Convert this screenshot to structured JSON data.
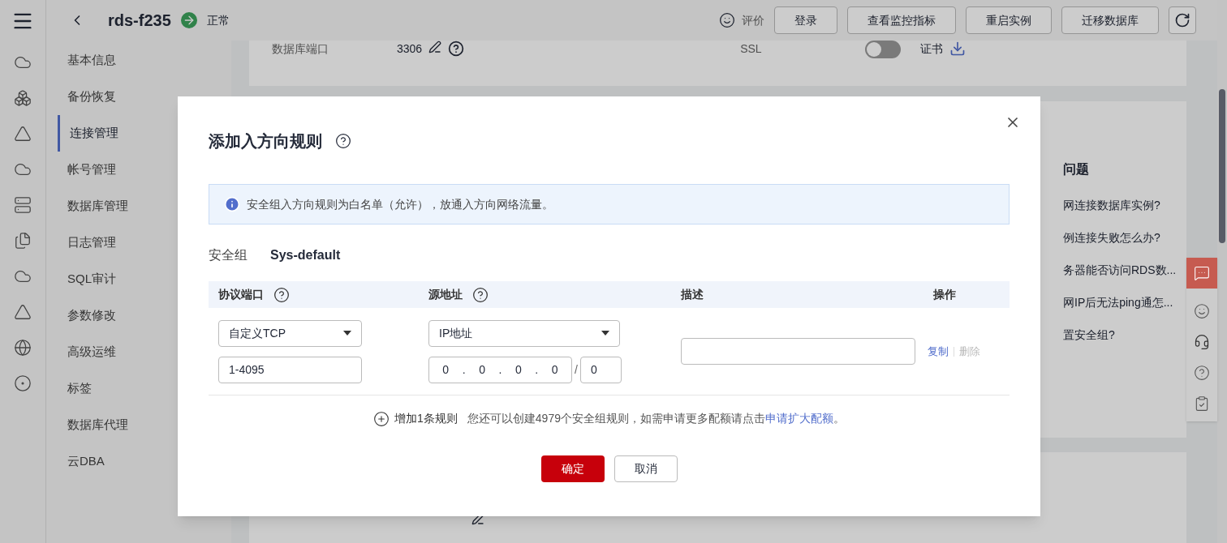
{
  "header": {
    "title": "rds-f235",
    "status": "正常",
    "rate_label": "评价",
    "actions": [
      "登录",
      "查看监控指标",
      "重启实例",
      "迁移数据库"
    ]
  },
  "nav": [
    {
      "label": "基本信息",
      "selected": false
    },
    {
      "label": "备份恢复",
      "selected": false
    },
    {
      "label": "连接管理",
      "selected": true
    },
    {
      "label": "帐号管理",
      "selected": false
    },
    {
      "label": "数据库管理",
      "selected": false
    },
    {
      "label": "日志管理",
      "selected": false
    },
    {
      "label": "SQL审计",
      "selected": false
    },
    {
      "label": "参数修改",
      "selected": false
    },
    {
      "label": "高级运维",
      "selected": false
    },
    {
      "label": "标签",
      "selected": false
    },
    {
      "label": "数据库代理",
      "selected": false
    },
    {
      "label": "云DBA",
      "selected": false
    }
  ],
  "background": {
    "port_label": "数据库端口",
    "port_value": "3306",
    "ssl_label": "SSL",
    "ssl_on": false,
    "cert_label": "证书",
    "faq_title": "问题",
    "faq_items": [
      "网连接数据库实例?",
      "例连接失败怎么办?",
      "务器能否访问RDS数...",
      "网IP后无法ping通怎...",
      "置安全组?"
    ]
  },
  "dialog": {
    "title": "添加入方向规则",
    "notice": "安全组入方向规则为白名单（允许），放通入方向网络流量。",
    "group_label": "安全组",
    "group_value": "Sys-default",
    "columns": [
      {
        "label": "协议端口",
        "help": true
      },
      {
        "label": "源地址",
        "help": true
      },
      {
        "label": "描述",
        "help": false
      },
      {
        "label": "操作",
        "help": false
      }
    ],
    "rules": [
      {
        "protocol": "自定义TCP",
        "port": "1-4095",
        "source_type": "IP地址",
        "ip_parts": [
          "0",
          "0",
          "0",
          "0"
        ],
        "ip_separator": ".",
        "mask_separator": "/",
        "mask": "0",
        "actions": [
          {
            "label": "复制",
            "disabled": false
          },
          {
            "label": "删除",
            "disabled": true
          }
        ]
      }
    ],
    "add_label": "增加1条规则",
    "quota_text": "您还可以创建4979个安全组规则，如需申请更多配额请点击",
    "quota_link": "申请扩大配额",
    "quota_end": "。",
    "buttons": [
      {
        "label": "确定",
        "kind": "primary"
      },
      {
        "label": "取消",
        "kind": "default"
      }
    ]
  }
}
